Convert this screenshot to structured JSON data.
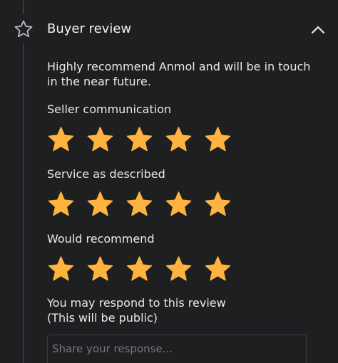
{
  "header": {
    "title": "Buyer review",
    "icon": "star-outline-icon",
    "collapse_icon": "chevron-up-icon"
  },
  "review": {
    "text": "Highly recommend Anmol and will be in touch in the near future."
  },
  "ratings": [
    {
      "label": "Seller communication",
      "stars": 5,
      "max": 5
    },
    {
      "label": "Service as described",
      "stars": 5,
      "max": 5
    },
    {
      "label": "Would recommend",
      "stars": 5,
      "max": 5
    }
  ],
  "response": {
    "prompt_line1": "You may respond to this review",
    "prompt_line2": "(This will be public)",
    "placeholder": "Share your response..."
  },
  "colors": {
    "background": "#1e1f21",
    "star": "#ffb33f",
    "text": "#e9e9ea"
  }
}
